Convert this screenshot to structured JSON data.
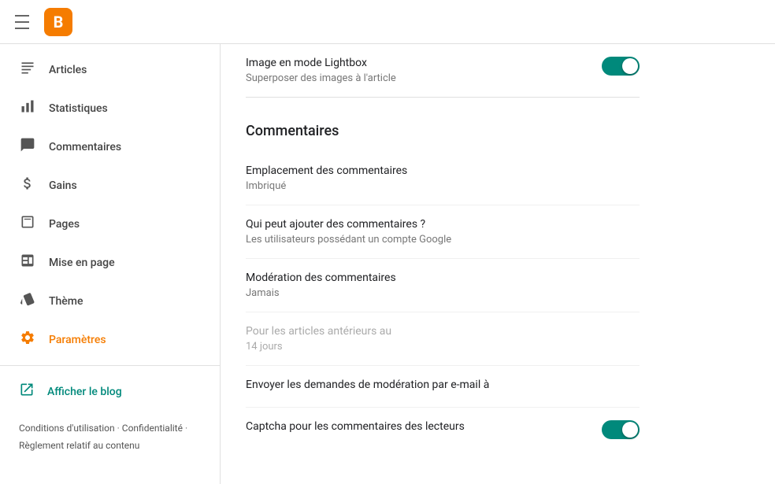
{
  "topbar": {
    "logo_letter": "B"
  },
  "sidebar": {
    "items": [
      {
        "id": "articles",
        "label": "Articles",
        "icon": "☰"
      },
      {
        "id": "statistiques",
        "label": "Statistiques",
        "icon": "📊"
      },
      {
        "id": "commentaires",
        "label": "Commentaires",
        "icon": "💬"
      },
      {
        "id": "gains",
        "label": "Gains",
        "icon": "$"
      },
      {
        "id": "pages",
        "label": "Pages",
        "icon": "⬜"
      },
      {
        "id": "mise-en-page",
        "label": "Mise en page",
        "icon": "▭"
      },
      {
        "id": "theme",
        "label": "Thème",
        "icon": "🖌"
      },
      {
        "id": "parametres",
        "label": "Paramètres",
        "icon": "⚙",
        "active": true
      }
    ],
    "view_blog_label": "Afficher le blog",
    "footer": {
      "terms": "Conditions d'utilisation",
      "privacy": "Confidentialité",
      "content": "Règlement relatif au contenu"
    }
  },
  "main": {
    "lightbox_section": {
      "title": "Image en mode Lightbox",
      "subtitle": "Superposer des images à l'article",
      "toggle_on": true
    },
    "comments_section": {
      "heading": "Commentaires",
      "rows": [
        {
          "id": "emplacement",
          "title": "Emplacement des commentaires",
          "value": "Imbriqué",
          "disabled": false,
          "toggle": false
        },
        {
          "id": "qui-peut",
          "title": "Qui peut ajouter des commentaires ?",
          "value": "Les utilisateurs possédant un compte Google",
          "disabled": false,
          "toggle": false
        },
        {
          "id": "moderation",
          "title": "Modération des commentaires",
          "value": "Jamais",
          "disabled": false,
          "toggle": false
        },
        {
          "id": "articles-anterieurs",
          "title": "Pour les articles antérieurs au",
          "value": "14 jours",
          "disabled": true,
          "toggle": false
        },
        {
          "id": "envoyer-demandes",
          "title": "Envoyer les demandes de modération par e-mail à",
          "value": "",
          "disabled": false,
          "toggle": false
        },
        {
          "id": "captcha",
          "title": "Captcha pour les commentaires des lecteurs",
          "value": "",
          "disabled": false,
          "toggle": true,
          "toggle_on": true
        }
      ]
    }
  }
}
